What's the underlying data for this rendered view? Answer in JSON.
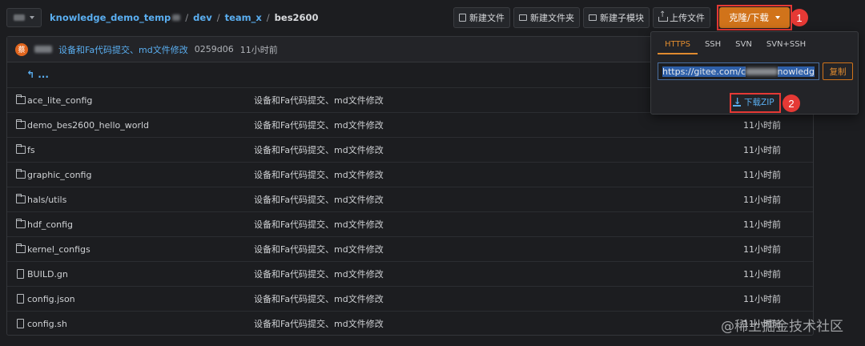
{
  "header": {
    "breadcrumb": [
      {
        "label": "knowledge_demo_temp",
        "type": "link"
      },
      {
        "label": "dev",
        "type": "link"
      },
      {
        "label": "team_x",
        "type": "link"
      },
      {
        "label": "bes2600",
        "type": "current"
      }
    ]
  },
  "toolbar": {
    "new_file": "新建文件",
    "new_folder": "新建文件夹",
    "new_submodule": "新建子模块",
    "upload_file": "上传文件",
    "clone_download": "克隆/下载"
  },
  "commit": {
    "avatar_letter": "蔡",
    "message": "设备和Fa代码提交、md文件修改",
    "hash": "0259d06",
    "time": "11小时前"
  },
  "parent_link": "...",
  "files": [
    {
      "name": "ace_lite_config",
      "type": "folder",
      "message": "设备和Fa代码提交、md文件修改",
      "time": "11小时前"
    },
    {
      "name": "demo_bes2600_hello_world",
      "type": "folder",
      "message": "设备和Fa代码提交、md文件修改",
      "time": "11小时前"
    },
    {
      "name": "fs",
      "type": "folder",
      "message": "设备和Fa代码提交、md文件修改",
      "time": "11小时前"
    },
    {
      "name": "graphic_config",
      "type": "folder",
      "message": "设备和Fa代码提交、md文件修改",
      "time": "11小时前"
    },
    {
      "name": "hals/utils",
      "type": "folder",
      "message": "设备和Fa代码提交、md文件修改",
      "time": "11小时前"
    },
    {
      "name": "hdf_config",
      "type": "folder",
      "message": "设备和Fa代码提交、md文件修改",
      "time": "11小时前"
    },
    {
      "name": "kernel_configs",
      "type": "folder",
      "message": "设备和Fa代码提交、md文件修改",
      "time": "11小时前"
    },
    {
      "name": "BUILD.gn",
      "type": "file",
      "message": "设备和Fa代码提交、md文件修改",
      "time": "11小时前"
    },
    {
      "name": "config.json",
      "type": "file",
      "message": "设备和Fa代码提交、md文件修改",
      "time": "11小时前"
    },
    {
      "name": "config.sh",
      "type": "file",
      "message": "设备和Fa代码提交、md文件修改",
      "time": "11小时前"
    }
  ],
  "dropdown": {
    "tabs": [
      "HTTPS",
      "SSH",
      "SVN",
      "SVN+SSH"
    ],
    "active_tab": "HTTPS",
    "url_prefix": "https://gitee.com/c",
    "url_suffix": "nowledg",
    "copy_label": "复制",
    "download_zip": "下载ZIP"
  },
  "annotations": {
    "step1": "1",
    "step2": "2"
  },
  "watermark": "@稀土掘金技术社区",
  "colors": {
    "accent_orange": "#d1731a",
    "link_blue": "#5aaef0",
    "highlight_red": "#e53935",
    "background": "#1c1d20"
  }
}
